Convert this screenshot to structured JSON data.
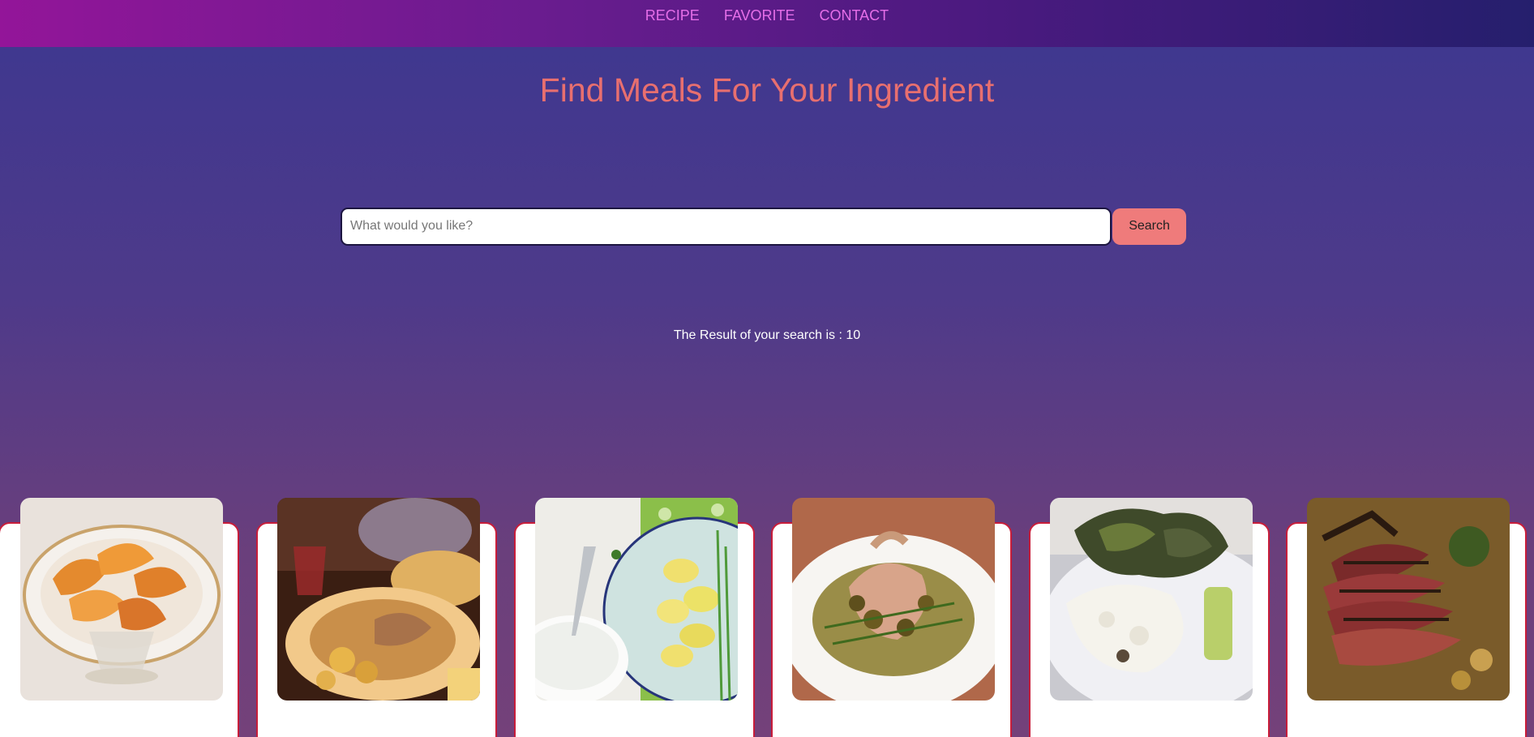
{
  "nav": {
    "items": [
      "RECIPE",
      "FAVORITE",
      "CONTACT"
    ]
  },
  "title": "Find Meals For Your Ingredient",
  "search": {
    "placeholder": "What would you like?",
    "value": "",
    "button_label": "Search"
  },
  "result": {
    "text": "The Result of your search is : 10"
  },
  "colors": {
    "accent": "#ef7b7b",
    "title": "#e86f6f",
    "nav_link": "#e56ee8",
    "card_border": "#c81d3a"
  }
}
